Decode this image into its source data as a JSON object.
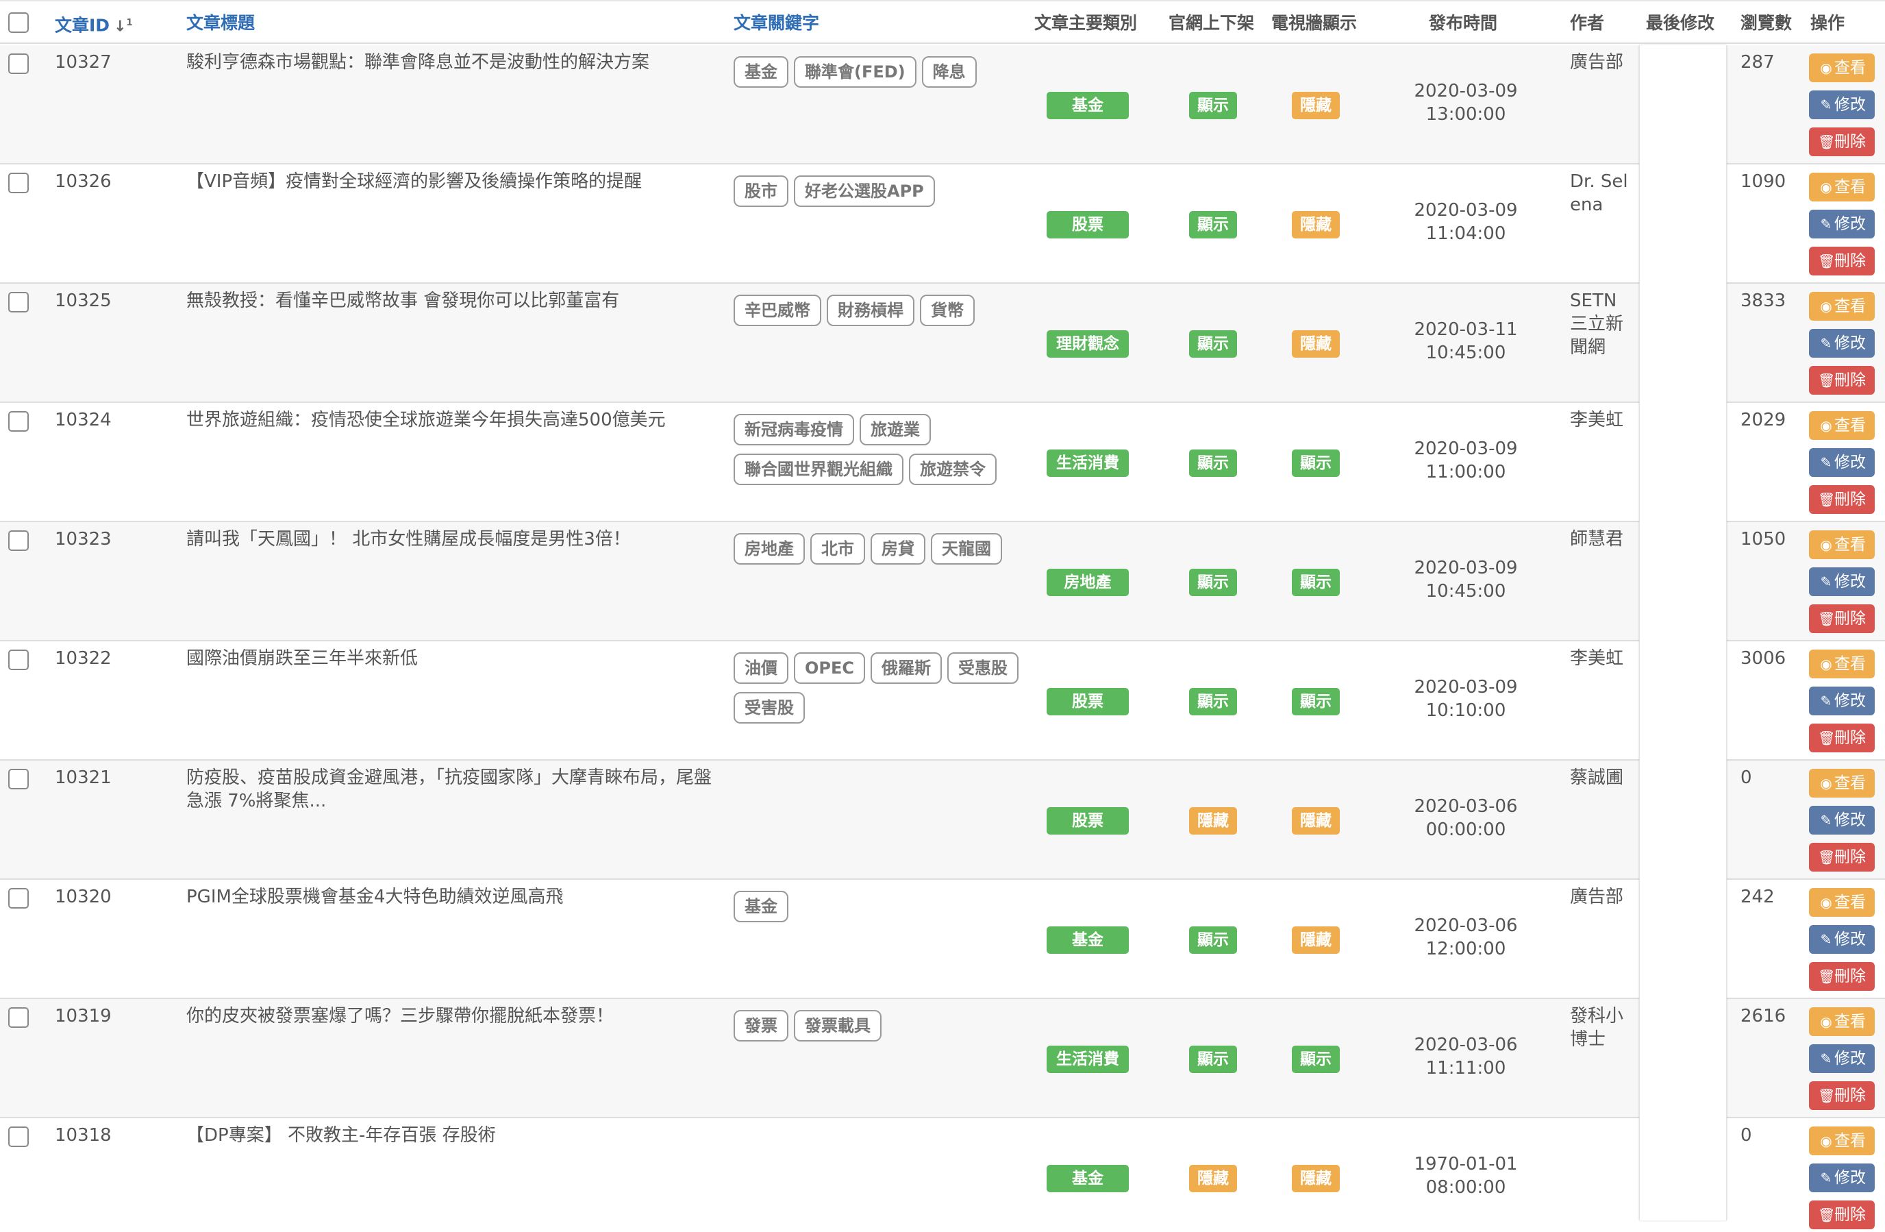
{
  "colors": {
    "category_green": "#5cb85c",
    "status_show": "#5cb85c",
    "status_hide": "#f0ad4e",
    "btn_view": "#f0ad4e",
    "btn_edit": "#5b7aa8",
    "btn_delete": "#d9534f",
    "header_blue": "#2f6db5"
  },
  "headers": {
    "id": "文章ID",
    "title": "文章標題",
    "keywords": "文章關鍵字",
    "category": "文章主要類別",
    "site": "官網上下架",
    "tv": "電視牆顯示",
    "publish": "發布時間",
    "author": "作者",
    "lastmod": "最後修改",
    "views": "瀏覽數",
    "actions": "操作"
  },
  "sort_icon": "sort-numeric-desc-icon",
  "buttons": {
    "view": "查看",
    "edit": "修改",
    "delete": "刪除"
  },
  "rows": [
    {
      "id": "10327",
      "title": "駿利亨德森市場觀點：聯準會降息並不是波動性的解決方案",
      "keywords": [
        "基金",
        "聯準會(FED)",
        "降息"
      ],
      "category": "基金",
      "site": "顯示",
      "tv": "隱藏",
      "date": "2020-03-09",
      "time": "13:00:00",
      "author": "廣告部",
      "views": "287"
    },
    {
      "id": "10326",
      "title": "【VIP音頻】疫情對全球經濟的影響及後續操作策略的提醒",
      "keywords": [
        "股市",
        "好老公選股APP"
      ],
      "category": "股票",
      "site": "顯示",
      "tv": "隱藏",
      "date": "2020-03-09",
      "time": "11:04:00",
      "author": "Dr. Selena",
      "views": "1090"
    },
    {
      "id": "10325",
      "title": "無殼教授：看懂辛巴威幣故事 會發現你可以比郭董富有",
      "keywords": [
        "辛巴威幣",
        "財務槓桿",
        "貨幣"
      ],
      "category": "理財觀念",
      "site": "顯示",
      "tv": "隱藏",
      "date": "2020-03-11",
      "time": "10:45:00",
      "author": "SETN三立新聞網",
      "views": "3833"
    },
    {
      "id": "10324",
      "title": "世界旅遊組織：疫情恐使全球旅遊業今年損失高達500億美元",
      "keywords": [
        "新冠病毒疫情",
        "旅遊業",
        "聯合國世界觀光組織",
        "旅遊禁令"
      ],
      "category": "生活消費",
      "site": "顯示",
      "tv": "顯示",
      "date": "2020-03-09",
      "time": "11:00:00",
      "author": "李美虹",
      "views": "2029"
    },
    {
      "id": "10323",
      "title": "請叫我「天鳳國」！ 北市女性購屋成長幅度是男性3倍！",
      "keywords": [
        "房地產",
        "北市",
        "房貸",
        "天龍國"
      ],
      "category": "房地產",
      "site": "顯示",
      "tv": "顯示",
      "date": "2020-03-09",
      "time": "10:45:00",
      "author": "師慧君",
      "views": "1050"
    },
    {
      "id": "10322",
      "title": "國際油價崩跌至三年半來新低",
      "keywords": [
        "油價",
        "OPEC",
        "俄羅斯",
        "受惠股",
        "受害股"
      ],
      "category": "股票",
      "site": "顯示",
      "tv": "顯示",
      "date": "2020-03-09",
      "time": "10:10:00",
      "author": "李美虹",
      "views": "3006"
    },
    {
      "id": "10321",
      "title": "防疫股、疫苗股成資金避風港，「抗疫國家隊」大摩青睞布局，尾盤急漲 7%將聚焦...",
      "keywords": [],
      "category": "股票",
      "site": "隱藏",
      "tv": "隱藏",
      "date": "2020-03-06",
      "time": "00:00:00",
      "author": "蔡誠圃",
      "views": "0"
    },
    {
      "id": "10320",
      "title": "PGIM全球股票機會基金4大特色助績效逆風高飛",
      "keywords": [
        "基金"
      ],
      "category": "基金",
      "site": "顯示",
      "tv": "隱藏",
      "date": "2020-03-06",
      "time": "12:00:00",
      "author": "廣告部",
      "views": "242"
    },
    {
      "id": "10319",
      "title": "你的皮夾被發票塞爆了嗎？三步驟帶你擺脫紙本發票！",
      "keywords": [
        "發票",
        "發票載具"
      ],
      "category": "生活消費",
      "site": "顯示",
      "tv": "顯示",
      "date": "2020-03-06",
      "time": "11:11:00",
      "author": "發科小博士",
      "views": "2616"
    },
    {
      "id": "10318",
      "title": "【DP專案】 不敗教主-年存百張 存股術",
      "keywords": [],
      "category": "基金",
      "site": "隱藏",
      "tv": "隱藏",
      "date": "1970-01-01",
      "time": "08:00:00",
      "author": "",
      "views": "0"
    }
  ]
}
